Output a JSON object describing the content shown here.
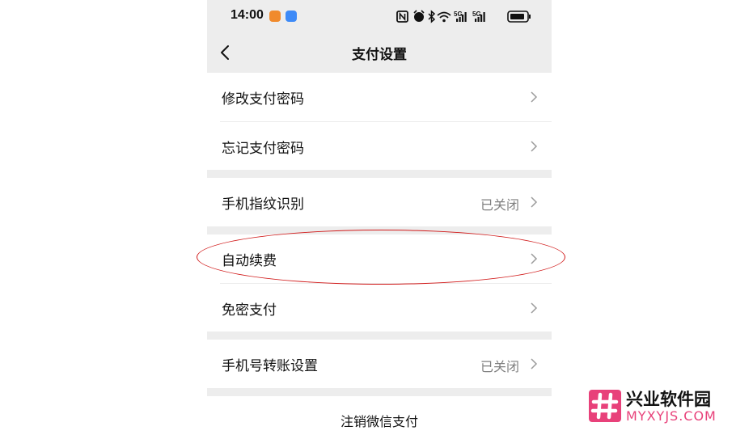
{
  "status_bar": {
    "time": "14:00",
    "network_1": "5G",
    "network_2": "5G",
    "icons": [
      "nfc-icon",
      "alarm-icon",
      "bluetooth-icon",
      "wifi-icon",
      "signal-icon",
      "signal-icon",
      "battery-icon"
    ]
  },
  "nav": {
    "title": "支付设置",
    "back_icon": "chevron-left-icon"
  },
  "settings": {
    "change_password": "修改支付密码",
    "forgot_password": "忘记支付密码",
    "fingerprint": {
      "label": "手机指纹识别",
      "value": "已关闭"
    },
    "auto_renew": "自动续费",
    "password_free": "免密支付",
    "phone_transfer": {
      "label": "手机号转账设置",
      "value": "已关闭"
    }
  },
  "footer": {
    "deregister": "注销微信支付"
  },
  "watermark": {
    "title": "兴业软件园",
    "domain": "MYXYJS.COM",
    "brand_color": "#e8417a"
  },
  "colors": {
    "page_gray": "#ededed",
    "annotation_red": "#d11a1a"
  }
}
